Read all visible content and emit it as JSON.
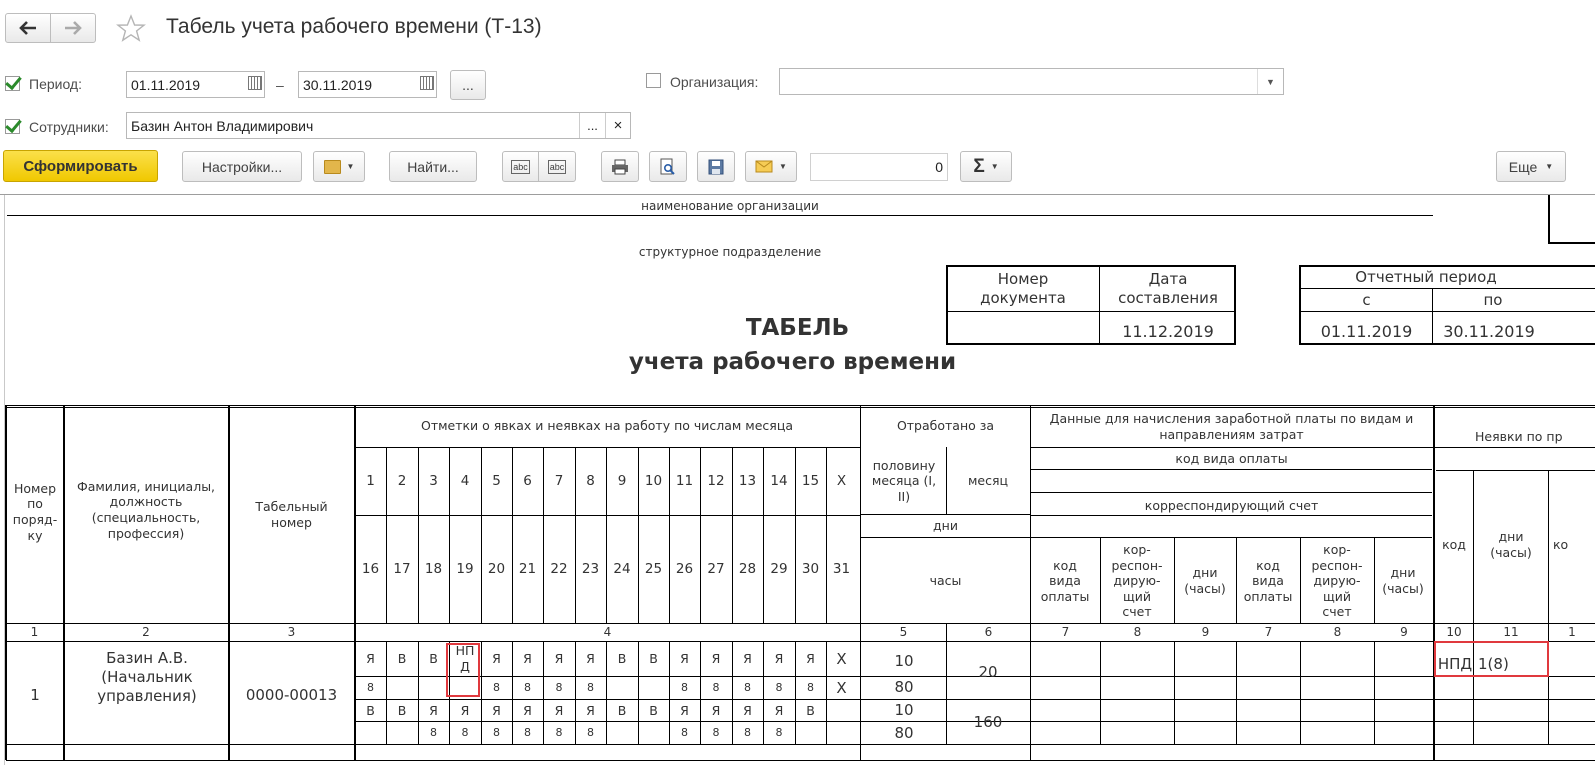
{
  "window": {
    "title": "Табель учета рабочего времени (Т-13)"
  },
  "filters": {
    "period_label": "Период:",
    "period_from": "01.11.2019",
    "period_dash": "–",
    "period_to": "30.11.2019",
    "period_more": "...",
    "org_label": "Организация:",
    "org_value": "",
    "employees_label": "Сотрудники:",
    "employees_value": "Базин Антон Владимирович",
    "employees_more": "...",
    "employees_clear": "×"
  },
  "toolbar": {
    "generate": "Сформировать",
    "settings": "Настройки...",
    "find": "Найти...",
    "sum_value": "0",
    "more": "Еще"
  },
  "report": {
    "org_caption": "наименование организации",
    "dept_caption": "структурное подразделение",
    "title_line1": "ТАБЕЛЬ",
    "title_line2": "учета  рабочего времени",
    "doc_number_header": "Номер документа",
    "doc_date_header": "Дата составления",
    "doc_number": "",
    "doc_date": "11.12.2019",
    "period_header": "Отчетный период",
    "period_from_header": "с",
    "period_to_header": "по",
    "period_from": "01.11.2019",
    "period_to": "30.11.2019"
  },
  "table": {
    "h_num": "Номер по поряд-ку",
    "h_name": "Фамилия, инициалы, должность (специальность, профессия)",
    "h_tab": "Табельный номер",
    "h_marks": "Отметки о явках и неявках на работу по числам месяца",
    "h_worked": "Отработано за",
    "h_half": "половину месяца (I, II)",
    "h_month": "месяц",
    "h_days": "дни",
    "h_hours": "часы",
    "h_pay": "Данные для начисления заработной платы по видам и направлениям затрат",
    "h_pay_code": "код вида оплаты",
    "h_corr": "корреспондирующий счет",
    "h_sub_code": "код вида оплаты",
    "h_sub_corr": "кор-респон-дирую-щий счет",
    "h_sub_days": "дни (часы)",
    "h_absence": "Неявки по пр",
    "h_abs_code": "код",
    "h_abs_days": "дни (часы)",
    "h_abs_ko": "ко",
    "days1": [
      "1",
      "2",
      "3",
      "4",
      "5",
      "6",
      "7",
      "8",
      "9",
      "10",
      "11",
      "12",
      "13",
      "14",
      "15",
      "X"
    ],
    "days2": [
      "16",
      "17",
      "18",
      "19",
      "20",
      "21",
      "22",
      "23",
      "24",
      "25",
      "26",
      "27",
      "28",
      "29",
      "30",
      "31"
    ],
    "colnums": [
      "1",
      "2",
      "3",
      "4",
      "5",
      "6",
      "7",
      "8",
      "9",
      "7",
      "8",
      "9",
      "10",
      "11",
      "1"
    ],
    "employee": {
      "num": "1",
      "name": "Базин А.В. (Начальник управления)",
      "tab": "0000-00013",
      "marks1": [
        "Я",
        "В",
        "В",
        "НП Д",
        "Я",
        "Я",
        "Я",
        "Я",
        "В",
        "В",
        "Я",
        "Я",
        "Я",
        "Я",
        "Я",
        "Х"
      ],
      "hours1": [
        "8",
        "",
        "",
        "",
        "8",
        "8",
        "8",
        "8",
        "",
        "",
        "8",
        "8",
        "8",
        "8",
        "8",
        "Х"
      ],
      "marks2": [
        "В",
        "В",
        "Я",
        "Я",
        "Я",
        "Я",
        "Я",
        "Я",
        "В",
        "В",
        "Я",
        "Я",
        "Я",
        "Я",
        "В",
        ""
      ],
      "hours2": [
        "",
        "",
        "8",
        "8",
        "8",
        "8",
        "8",
        "8",
        "",
        "",
        "8",
        "8",
        "8",
        "8",
        "",
        ""
      ],
      "half1_days": "10",
      "half1_hours": "80",
      "half2_days": "10",
      "half2_hours": "80",
      "month_days": "20",
      "month_hours": "160",
      "abs_code": "НПД",
      "abs_days": "1(8)"
    }
  },
  "colors": {
    "accent": "#f5d10f",
    "highlight": "#e0393e"
  }
}
